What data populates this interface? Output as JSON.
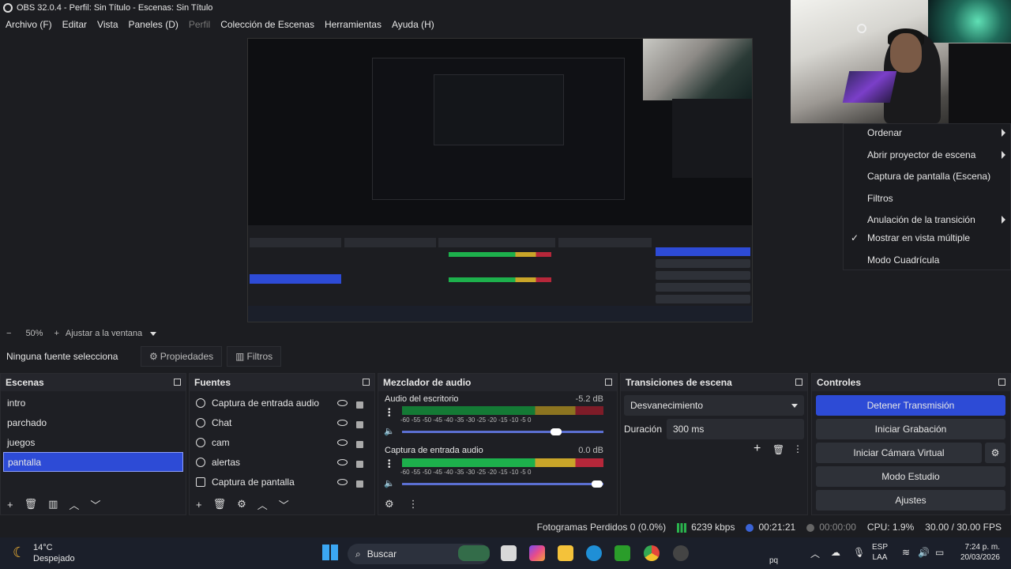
{
  "window": {
    "title": "OBS 32.0.4 - Perfil: Sin Título - Escenas: Sin Título"
  },
  "menu": [
    "Archivo (F)",
    "Editar",
    "Vista",
    "Paneles (D)",
    "Perfil",
    "Colección de Escenas",
    "Herramientas",
    "Ayuda (H)"
  ],
  "context_menu": {
    "items": [
      "Ordenar",
      "Abrir proyector de escena",
      "Captura de pantalla (Escena)",
      "Filtros",
      "Anulación de la transición",
      "Mostrar en vista múltiple",
      "Modo Cuadrícula"
    ],
    "checked": "Mostrar en vista múltiple"
  },
  "zoom": {
    "minus": "−",
    "value": "50%",
    "plus": "+",
    "fit": "Ajustar a la ventana"
  },
  "props": {
    "no_source": "Ninguna fuente selecciona",
    "properties": "Propiedades",
    "filters": "Filtros"
  },
  "scenes": {
    "title": "Escenas",
    "items": [
      "intro",
      "parchado",
      "juegos",
      "pantalla"
    ],
    "selected": "pantalla"
  },
  "sources": {
    "title": "Fuentes",
    "items": [
      "Captura de entrada audio",
      "Chat",
      "cam",
      "alertas",
      "Captura de pantalla"
    ]
  },
  "mixer": {
    "title": "Mezclador de audio",
    "tracks": [
      {
        "name": "Audio del escritorio",
        "db": "-5.2 dB",
        "level": 0.05
      },
      {
        "name": "Captura de entrada audio",
        "db": "0.0 dB",
        "level": 0.7
      }
    ],
    "ticks": "-60   -55   -50   -45   -40   -35   -30   -25   -20   -15   -10    -5     0"
  },
  "transitions": {
    "title": "Transiciones de escena",
    "type": "Desvanecimiento",
    "duration_label": "Duración",
    "duration": "300 ms"
  },
  "controls": {
    "title": "Controles",
    "buttons": [
      "Detener Transmisión",
      "Iniciar Grabación",
      "Iniciar Cámara Virtual",
      "Modo Estudio",
      "Ajustes"
    ]
  },
  "status": {
    "dropped": "Fotogramas Perdidos 0 (0.0%)",
    "bitrate": "6239 kbps",
    "stream_time": "00:21:21",
    "rec_time": "00:00:00",
    "cpu": "CPU: 1.9%",
    "fps": "30.00 / 30.00 FPS"
  },
  "taskbar": {
    "weather_temp": "14°C",
    "weather_desc": "Despejado",
    "search": "Buscar",
    "lang": "ESP",
    "lang_sub": "LAA",
    "time": "7:24 p. m.",
    "date": "20/03/2026",
    "overlay_text": "pq"
  },
  "colors": {
    "accent": "#2d4bd6",
    "bg": "#1c1d21",
    "meter_green": "#1db04c",
    "meter_yellow": "#c9a529",
    "meter_red": "#b6273a"
  }
}
